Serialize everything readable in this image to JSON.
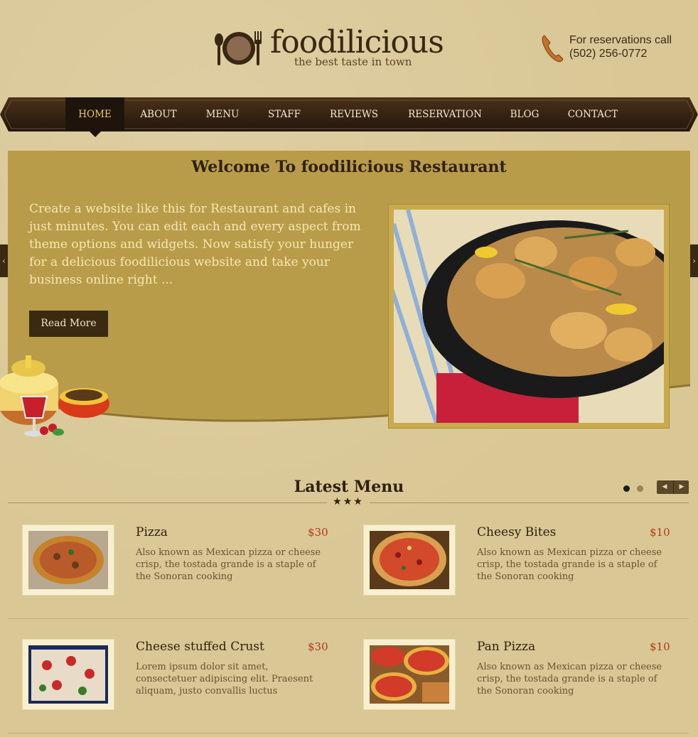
{
  "site": {
    "brand": "foodilicious",
    "tagline": "the best taste in town",
    "phone_label": "For reservations call",
    "phone_number": "(502) 256-0772"
  },
  "nav": {
    "items": [
      {
        "label": "HOME",
        "active": true
      },
      {
        "label": "ABOUT",
        "active": false
      },
      {
        "label": "MENU",
        "active": false
      },
      {
        "label": "STAFF",
        "active": false
      },
      {
        "label": "REVIEWS",
        "active": false
      },
      {
        "label": "RESERVATION",
        "active": false
      },
      {
        "label": "BLOG",
        "active": false
      },
      {
        "label": "CONTACT",
        "active": false
      }
    ]
  },
  "hero": {
    "title": "Welcome To foodilicious Restaurant",
    "text": "Create a website like this for Restaurant and cafes in just minutes. You can edit each and every aspect from theme options and widgets. Now satisfy your hunger for a delicious foodilicious website and take your business online right ...",
    "button": "Read More",
    "prev_arrow": "‹",
    "next_arrow": "›"
  },
  "latest_menu": {
    "title": "Latest Menu",
    "stars": "★★★",
    "pager_prev": "◀",
    "pager_next": "▶",
    "items": [
      {
        "name": "Pizza",
        "price": "$30",
        "desc": "Also known as Mexican pizza or cheese crisp, the tostada grande is a staple of the Sonoran cooking"
      },
      {
        "name": "Cheesy Bites",
        "price": "$10",
        "desc": "Also known as Mexican pizza or cheese crisp, the tostada grande is a staple of the Sonoran cooking"
      },
      {
        "name": "Cheese stuffed Crust",
        "price": "$30",
        "desc": "Lorem ipsum dolor sit amet, consectetuer adipiscing elit. Praesent aliquam, justo convallis luctus"
      },
      {
        "name": "Pan Pizza",
        "price": "$10",
        "desc": "Also known as Mexican pizza or cheese crisp, the tostada grande is a staple of the Sonoran cooking"
      }
    ]
  },
  "colors": {
    "background": "#d9c795",
    "nav_bg": "#2e1e10",
    "hero_bg": "#b89c4a",
    "price": "#b23a1a",
    "active_nav": "#e9c86a"
  }
}
